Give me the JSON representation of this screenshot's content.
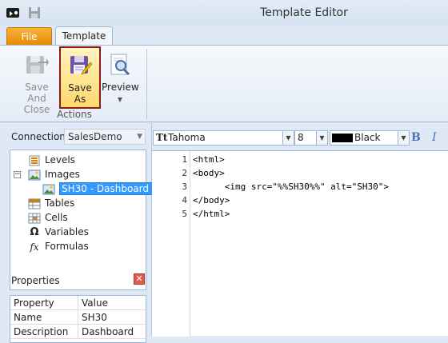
{
  "window": {
    "title": "Template Editor"
  },
  "ribbon": {
    "tabs": [
      {
        "label": "File"
      },
      {
        "label": "Template"
      }
    ],
    "actions": {
      "group_label": "Actions",
      "save_and_close": "Save And Close",
      "save_as": "Save As",
      "preview": "Preview"
    }
  },
  "connection": {
    "label": "Connection",
    "value": "SalesDemo"
  },
  "tree": {
    "items": [
      {
        "label": "Levels",
        "icon": "levels-icon"
      },
      {
        "label": "Images",
        "icon": "images-icon"
      },
      {
        "label": "SH30 - Dashboard",
        "icon": "image-item-icon",
        "selected": true
      },
      {
        "label": "Tables",
        "icon": "tables-icon"
      },
      {
        "label": "Cells",
        "icon": "cells-icon"
      },
      {
        "label": "Variables",
        "icon": "omega-icon"
      },
      {
        "label": "Formulas",
        "icon": "fx-icon"
      }
    ]
  },
  "properties": {
    "title": "Properties",
    "columns": [
      "Property",
      "Value"
    ],
    "rows": [
      {
        "property": "Name",
        "value": "SH30"
      },
      {
        "property": "Description",
        "value": "Dashboard"
      }
    ]
  },
  "editor_toolbar": {
    "font": "Tahoma",
    "size": "8",
    "color_name": "Black",
    "color_hex": "#000000",
    "bold": "B",
    "italic": "I"
  },
  "code": {
    "line_numbers": [
      "1",
      "2",
      "3",
      "4",
      "5"
    ],
    "lines": [
      "<html>",
      "<body>",
      "      <img src=\"%%SH30%%\" alt=\"SH30\">",
      "</body>",
      "</html>"
    ]
  },
  "colors": {
    "file_tab": "#e68a00",
    "selection": "#3399ff",
    "save_as_highlight": "#ffd86b",
    "save_as_border": "#8b1a1a"
  }
}
